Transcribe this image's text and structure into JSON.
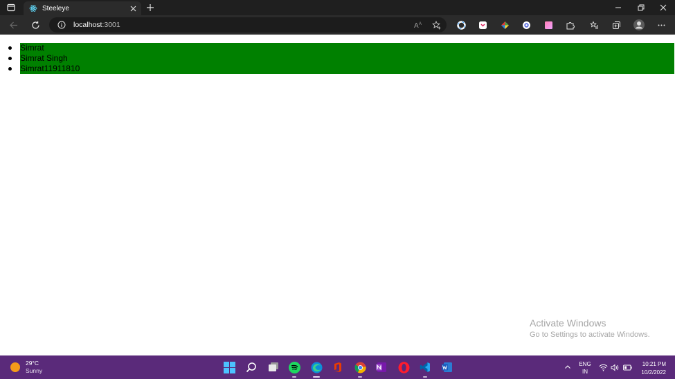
{
  "browser": {
    "tab_title": "Steeleye",
    "url_host": "localhost",
    "url_port": ":3001"
  },
  "page": {
    "users": [
      {
        "label": "Simrat"
      },
      {
        "label": "Simrat Singh"
      },
      {
        "label": "Simrat11911810"
      }
    ],
    "highlight_color": "#008000"
  },
  "watermark": {
    "title": "Activate Windows",
    "subtitle": "Go to Settings to activate Windows."
  },
  "taskbar": {
    "weather_temp": "29°C",
    "weather_condition": "Sunny",
    "language_line1": "ENG",
    "language_line2": "IN",
    "time": "10:21 PM",
    "date": "10/2/2022",
    "color": "#5a2a7a"
  }
}
